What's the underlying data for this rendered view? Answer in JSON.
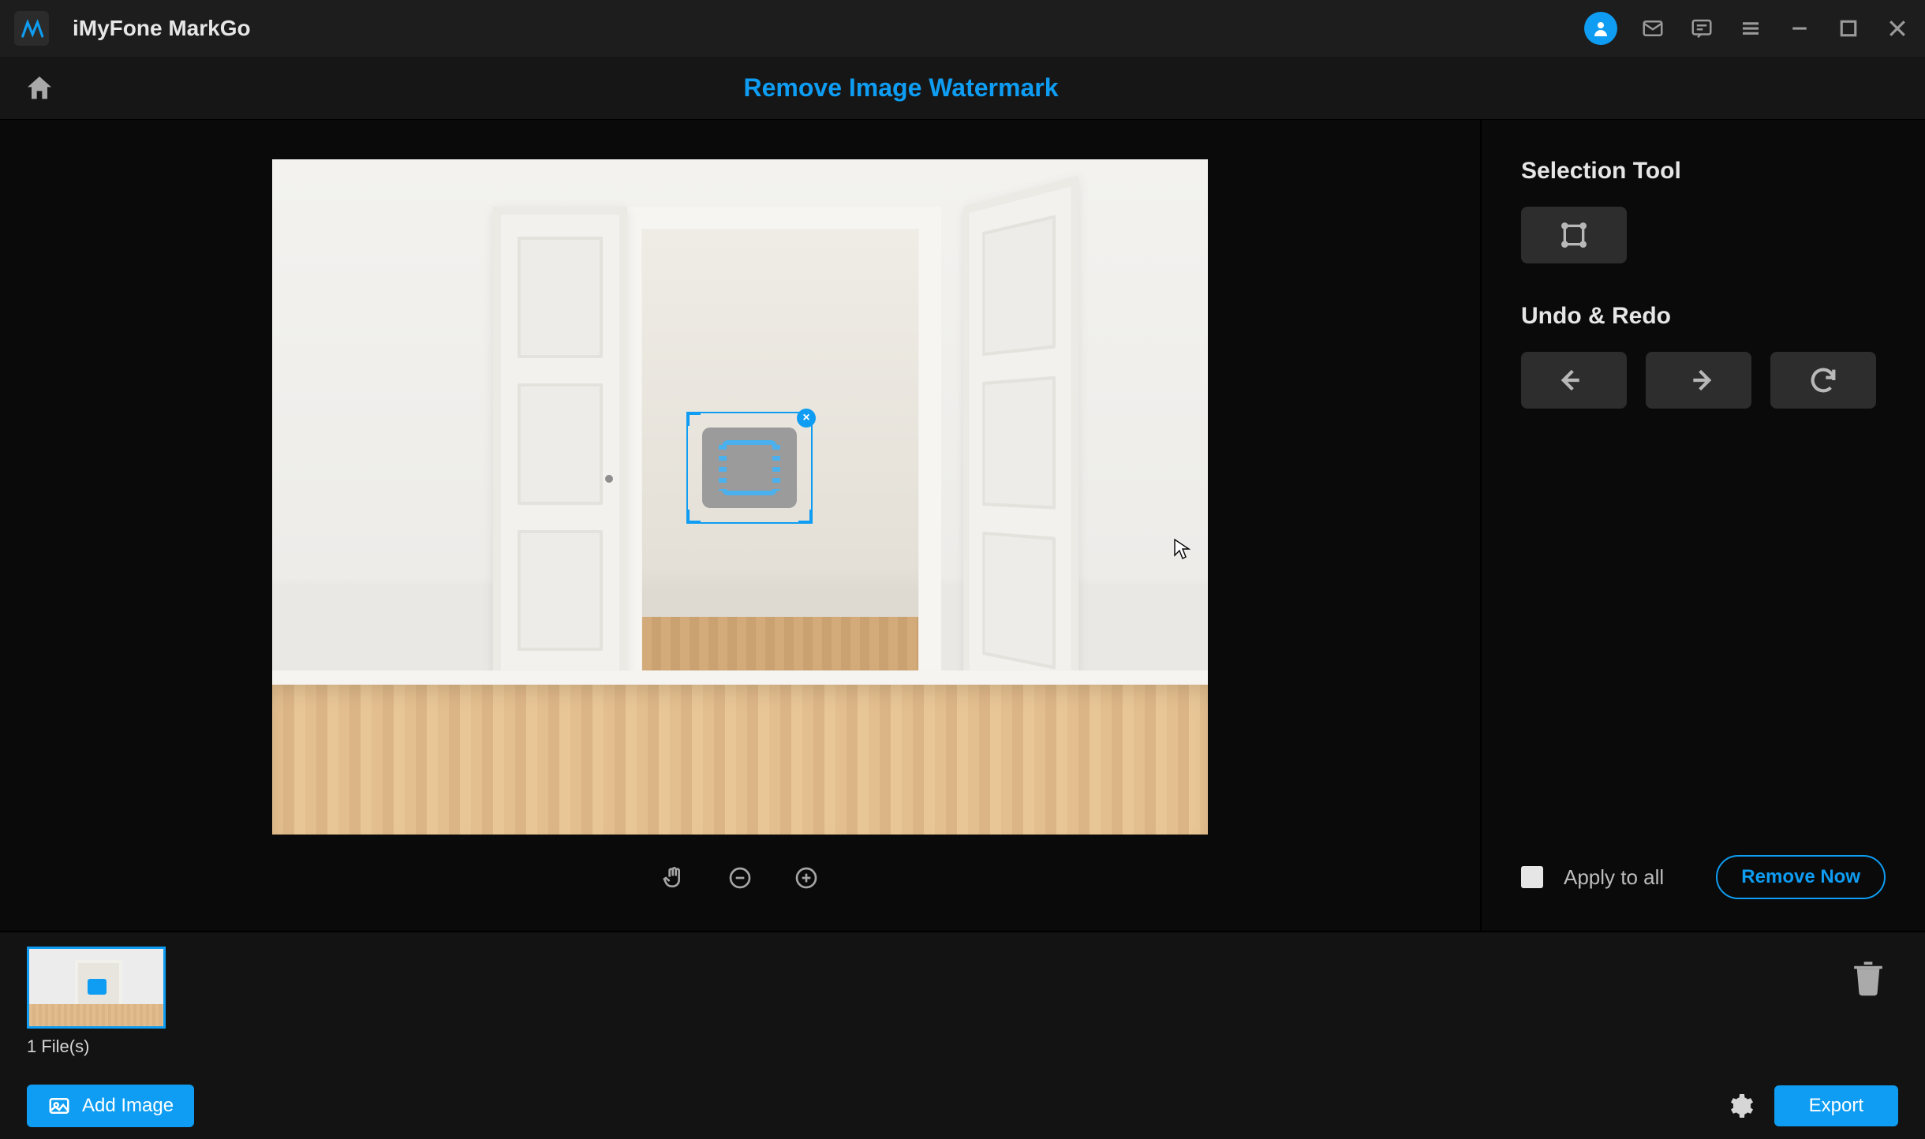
{
  "app": {
    "title": "iMyFone MarkGo"
  },
  "page": {
    "title": "Remove Image Watermark"
  },
  "sidebar": {
    "selection_title": "Selection Tool",
    "undo_redo_title": "Undo & Redo",
    "apply_all_label": "Apply to all",
    "remove_now_label": "Remove Now"
  },
  "thumbs": {
    "file_count": "1 File(s)"
  },
  "footer": {
    "add_image_label": "Add Image",
    "export_label": "Export"
  },
  "colors": {
    "accent": "#0e9df3"
  }
}
